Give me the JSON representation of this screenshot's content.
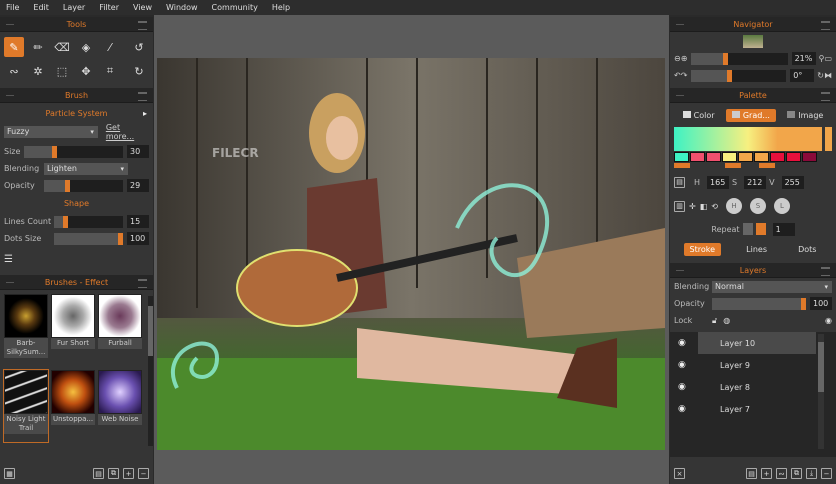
{
  "menu": [
    "File",
    "Edit",
    "Layer",
    "Filter",
    "View",
    "Window",
    "Community",
    "Help"
  ],
  "tools": {
    "title": "Tools"
  },
  "brush": {
    "title": "Brush",
    "system": "Particle System",
    "preset": "Fuzzy",
    "get_more": "Get more...",
    "size_label": "Size",
    "size": "30",
    "size_pct": 30,
    "blending_label": "Blending",
    "blending": "Lighten",
    "opacity_label": "Opacity",
    "opacity": "29",
    "opacity_pct": 29,
    "shape_title": "Shape",
    "lines_label": "Lines Count",
    "lines": "15",
    "lines_pct": 15,
    "dots_label": "Dots Size",
    "dots": "100",
    "dots_pct": 100
  },
  "brushes": {
    "title": "Brushes - Effect",
    "items": [
      "Barb-SilkySum...",
      "Fur Short",
      "Furball",
      "Noisy Light Trail",
      "Unstoppa...",
      "Web Noise"
    ]
  },
  "navigator": {
    "title": "Navigator",
    "zoom": "21%",
    "rotation": "0°",
    "zoom_pct": 21
  },
  "palette": {
    "title": "Palette",
    "tabs": [
      "Color",
      "Grad...",
      "Image"
    ],
    "h_label": "H",
    "h": "165",
    "s_label": "S",
    "s": "212",
    "v_label": "V",
    "v": "255",
    "swatches": [
      "#3ef2c4",
      "#f0506e",
      "#f0506e",
      "#f7f080",
      "#f2a64a",
      "#f2a64a",
      "#e8103c",
      "#e8103c",
      "#8a0a3a"
    ],
    "circles": [
      "H",
      "S",
      "L"
    ],
    "repeat_label": "Repeat",
    "repeat": "1",
    "modes": [
      "Stroke",
      "Lines",
      "Dots"
    ]
  },
  "layers": {
    "title": "Layers",
    "blending_label": "Blending",
    "blending": "Normal",
    "opacity_label": "Opacity",
    "opacity": "100",
    "lock_label": "Lock",
    "items": [
      "Layer 10",
      "Layer 9",
      "Layer 8",
      "Layer 7"
    ]
  },
  "watermark": "FILECR"
}
